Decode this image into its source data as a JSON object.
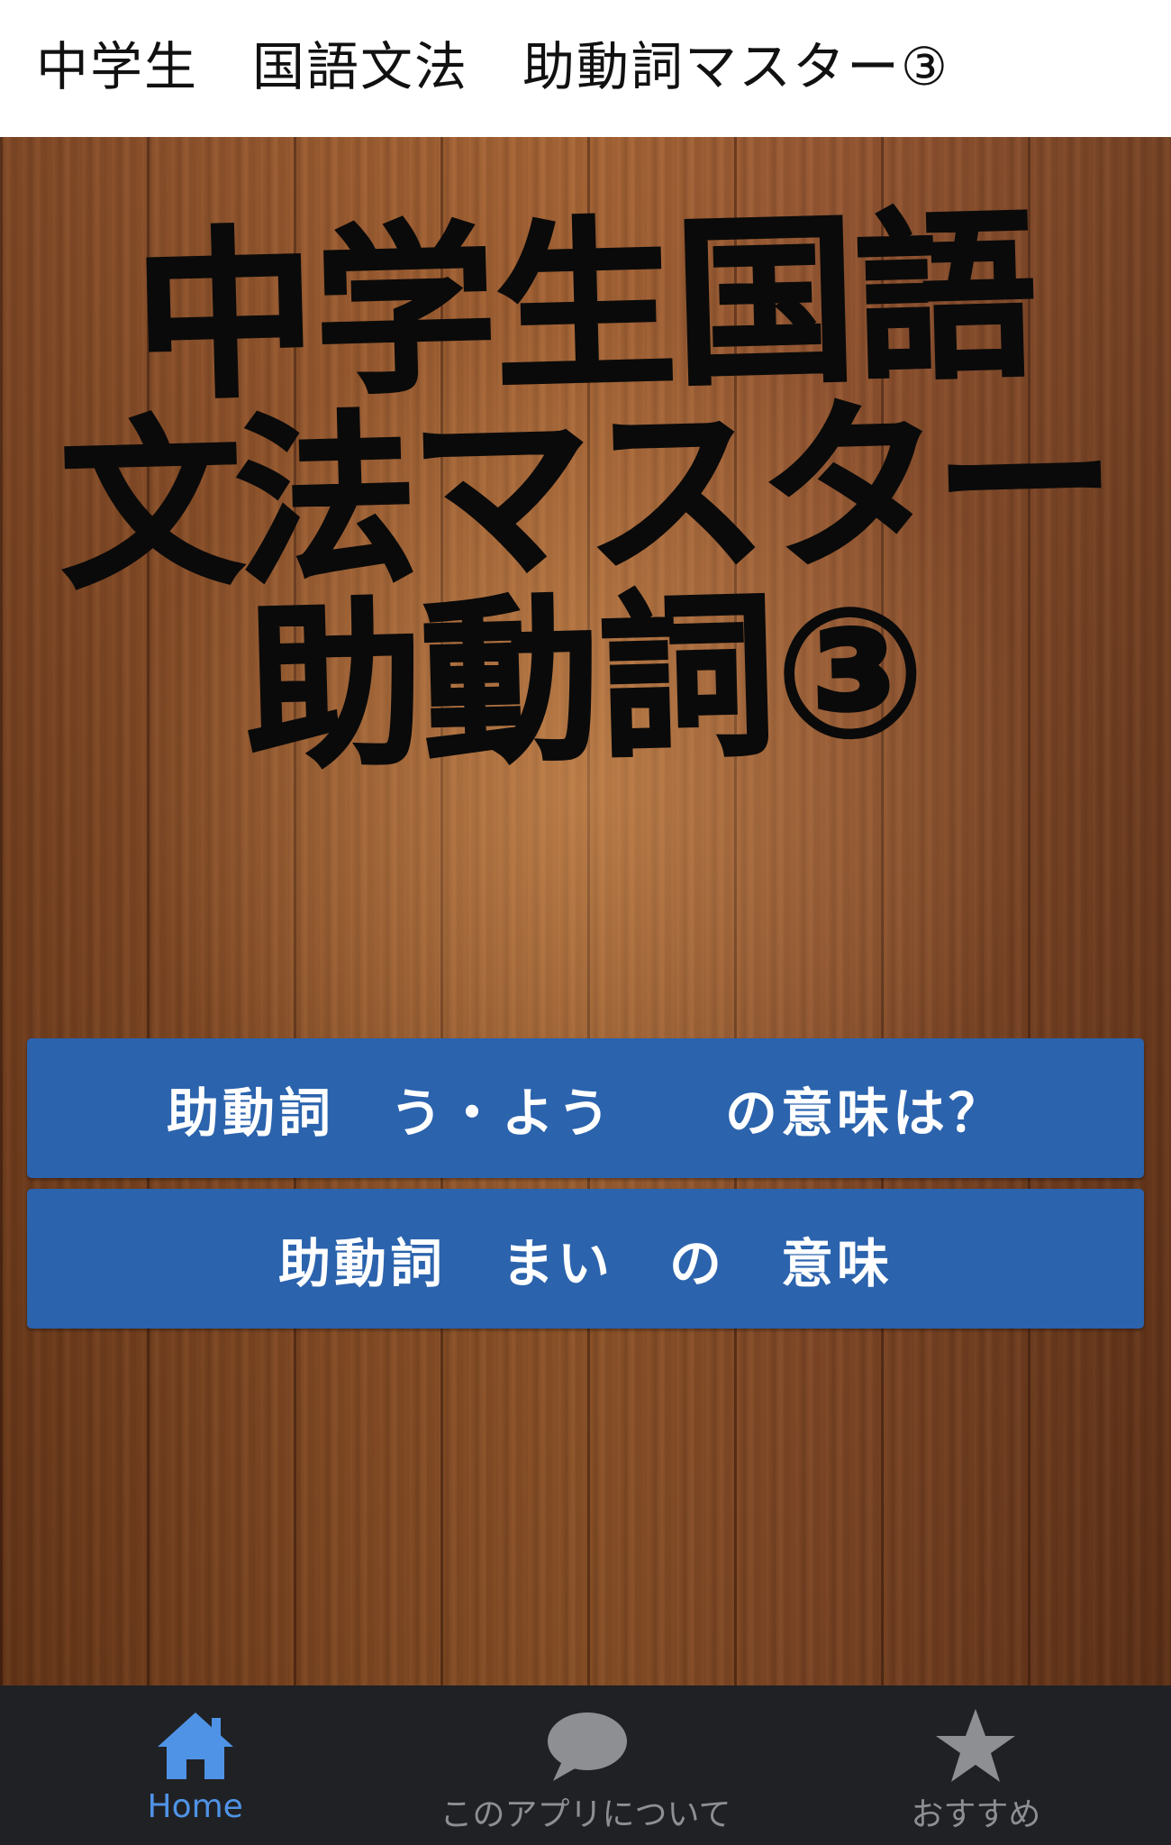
{
  "app_bar": {
    "title": "中学生　国語文法　助動詞マスター③"
  },
  "hero": {
    "line1": "中学生国語",
    "line2": "文法マスター",
    "line3": "助動詞③"
  },
  "menu": {
    "items": [
      {
        "label": "助動詞　う・よう　　の意味は？"
      },
      {
        "label": "助動詞　まい　の　意味"
      }
    ]
  },
  "bottom_nav": {
    "items": [
      {
        "label": "Home",
        "icon": "home-icon",
        "active": true
      },
      {
        "label": "このアプリについて",
        "icon": "speech-bubble-icon",
        "active": false
      },
      {
        "label": "おすすめ",
        "icon": "star-icon",
        "active": false
      }
    ]
  },
  "colors": {
    "app_bar_bg": "#ffffff",
    "button_bg": "#2b63ad",
    "nav_bg": "#202124",
    "nav_active": "#4f93e6",
    "nav_inactive": "#8d8f93"
  }
}
